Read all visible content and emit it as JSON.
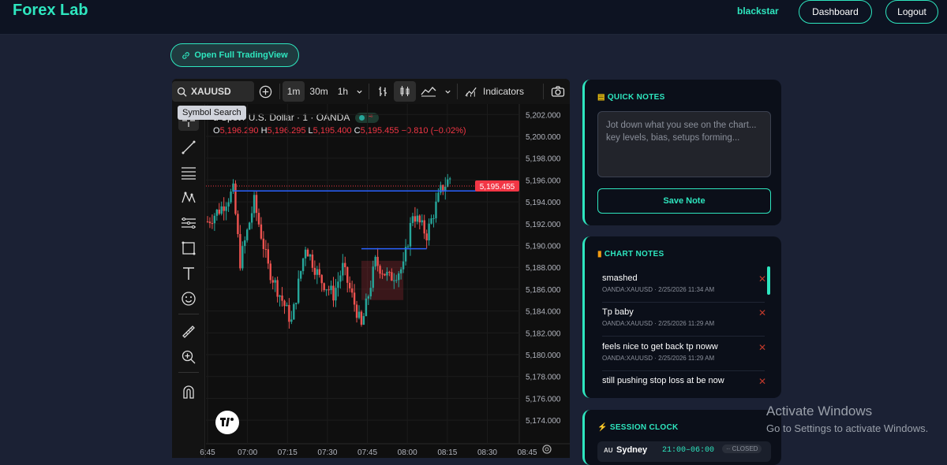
{
  "header": {
    "logo": "Forex Lab",
    "username": "blackstar",
    "dashboard_label": "Dashboard",
    "logout_label": "Logout"
  },
  "open_tradingview_label": "Open Full TradingView",
  "chart_widget": {
    "symbol": "XAUUSD",
    "intervals": [
      "1m",
      "30m",
      "1h"
    ],
    "active_interval": "1m",
    "indicators_label": "Indicators",
    "tooltip": "Symbol Search",
    "legend_title": "d Spot / U.S. Dollar · 1 · OANDA",
    "ohlc": {
      "o_label": "O",
      "o": "5,196.290",
      "h_label": "H",
      "h": "5,196.295",
      "l_label": "L",
      "l": "5,195.400",
      "c_label": "C",
      "c": "5,195.455",
      "change": "−0.810 (−0.02%)"
    },
    "last_price": "5,195.455",
    "colors": {
      "up": "#26a69a",
      "down": "#ef5350",
      "level_line": "#2962ff",
      "price_tag": "#f23645"
    }
  },
  "chart_data": {
    "type": "candlestick",
    "y_ticks": [
      "5,202.000",
      "5,200.000",
      "5,198.000",
      "5,196.000",
      "5,194.000",
      "5,192.000",
      "5,190.000",
      "5,188.000",
      "5,186.000",
      "5,184.000",
      "5,182.000",
      "5,180.000",
      "5,178.000",
      "5,176.000",
      "5,174.000"
    ],
    "x_ticks": [
      "6:45",
      "07:00",
      "07:15",
      "07:30",
      "07:45",
      "08:00",
      "08:15",
      "08:30",
      "08:45"
    ],
    "ylim": [
      5173,
      5202.6
    ],
    "xlim": [
      0,
      130
    ],
    "x_tick_pos": [
      0,
      17.14,
      34.29,
      51.43,
      68.57,
      85.71,
      102.86,
      120,
      137.14
    ],
    "horizontal_levels": [
      {
        "price": 5195.0,
        "from": 11,
        "to": 118
      },
      {
        "price": 5189.7,
        "from": 66,
        "to": 94
      }
    ],
    "box": {
      "y_top": 5188.6,
      "y_bottom": 5185.0,
      "from": 66,
      "to": 84
    },
    "last_price": 5195.455
  },
  "quick_notes": {
    "title": "QUICK NOTES",
    "placeholder": "Jot down what you see on the chart... key levels, bias, setups forming...",
    "save_label": "Save Note"
  },
  "chart_notes": {
    "title": "CHART NOTES",
    "items": [
      {
        "text": "smashed",
        "meta": "OANDA:XAUUSD · 2/25/2026 11:34 AM"
      },
      {
        "text": "Tp baby",
        "meta": "OANDA:XAUUSD · 2/25/2026 11:29 AM"
      },
      {
        "text": "feels nice to get back tp noww",
        "meta": "OANDA:XAUUSD · 2/25/2026 11:29 AM"
      },
      {
        "text": "still pushing stop loss at be now",
        "meta": ""
      }
    ]
  },
  "session_clock": {
    "title": "SESSION CLOCK",
    "rows": [
      {
        "flag": "AU",
        "name": "Sydney",
        "hours": "21:00–06:00",
        "status": "CLOSED"
      }
    ]
  },
  "os_watermark": {
    "line1": "Activate Windows",
    "line2": "Go to Settings to activate Windows."
  }
}
